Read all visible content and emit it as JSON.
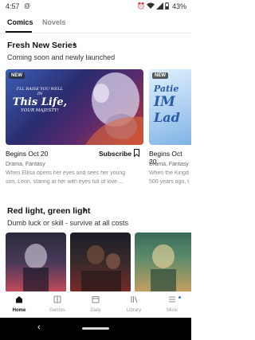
{
  "status_bar": {
    "time": "4:57",
    "battery": "43%",
    "icons": [
      "at-icon",
      "alarm-icon",
      "wifi-icon",
      "signal-icon",
      "battery-icon"
    ]
  },
  "tabs": [
    {
      "label": "Comics",
      "active": true
    },
    {
      "label": "Novels",
      "active": false
    }
  ],
  "fresh_section": {
    "title": "Fresh New Series",
    "subtitle": "Coming soon and newly launched",
    "cards": [
      {
        "badge": "NEW",
        "cover_text": [
          "I'LL RAISE YOU WELL",
          "IN",
          "This Life,",
          "YOUR MAJESTY!"
        ],
        "date": "Begins Oct 20",
        "subscribe_label": "Subscribe",
        "genre": "Drama, Fantasy",
        "description_line1": "When Ellisa opens her eyes and sees her young",
        "description_line2": "son, Leon, staring at her with eyes full of love ..."
      },
      {
        "badge": "NEW",
        "cover_text": [
          "Patie",
          "IM",
          "Lad"
        ],
        "date": "Begins Oct 20",
        "genre": "Drama, Fantasy",
        "description_line1": "When the Kingd",
        "description_line2": "500 years ago, t"
      }
    ]
  },
  "red_light_section": {
    "title": "Red light, green light",
    "subtitle": "Dumb luck or skill - survive at all costs"
  },
  "bottom_nav": [
    {
      "label": "Home",
      "icon": "home-icon",
      "active": true
    },
    {
      "label": "Genres",
      "icon": "genres-icon",
      "active": false
    },
    {
      "label": "Daily",
      "icon": "daily-icon",
      "active": false
    },
    {
      "label": "Library",
      "icon": "library-icon",
      "active": false
    },
    {
      "label": "More",
      "icon": "more-icon",
      "active": false
    }
  ],
  "colors": {
    "accent": "#111111",
    "badge_bg": "#3a3a3a",
    "notification_dot": "#2d7be0"
  }
}
